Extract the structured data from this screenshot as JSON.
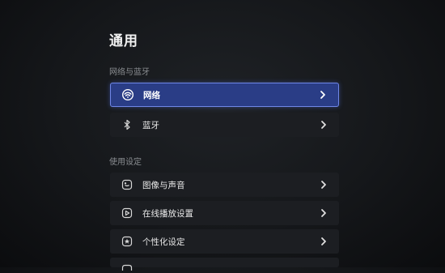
{
  "page": {
    "title": "通用"
  },
  "sections": [
    {
      "label": "网络与蓝牙"
    },
    {
      "label": "使用设定"
    }
  ],
  "items": [
    {
      "label": "网络",
      "icon": "wifi-icon",
      "selected": true
    },
    {
      "label": "蓝牙",
      "icon": "bluetooth-icon",
      "selected": false
    },
    {
      "label": "图像与声音",
      "icon": "picture-sound-icon",
      "selected": false
    },
    {
      "label": "在线播放设置",
      "icon": "play-icon",
      "selected": false
    },
    {
      "label": "个性化设定",
      "icon": "star-icon",
      "selected": false
    }
  ],
  "colors": {
    "selected_bg": "#2a3d86",
    "selected_border": "#6f86e6",
    "row_bg": "#1c1e22",
    "section_text": "#8a8d91"
  }
}
